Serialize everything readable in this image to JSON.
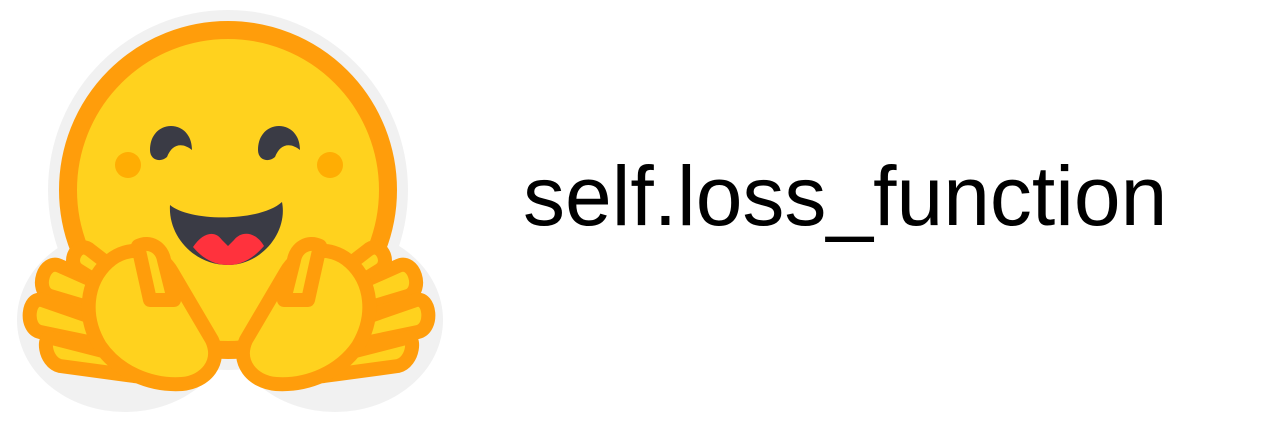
{
  "logo": {
    "icon": "hugging-face-emoji",
    "colors": {
      "face": "#FFD21E",
      "outline": "#FF9D0B",
      "eyes": "#3A3B45",
      "mouth": "#3A3B45",
      "tongue": "#FF323D",
      "cheeks": "#FFAD03",
      "halo": "#F1F1F1"
    }
  },
  "caption": {
    "text": "self.loss_function",
    "color": "#000000"
  }
}
